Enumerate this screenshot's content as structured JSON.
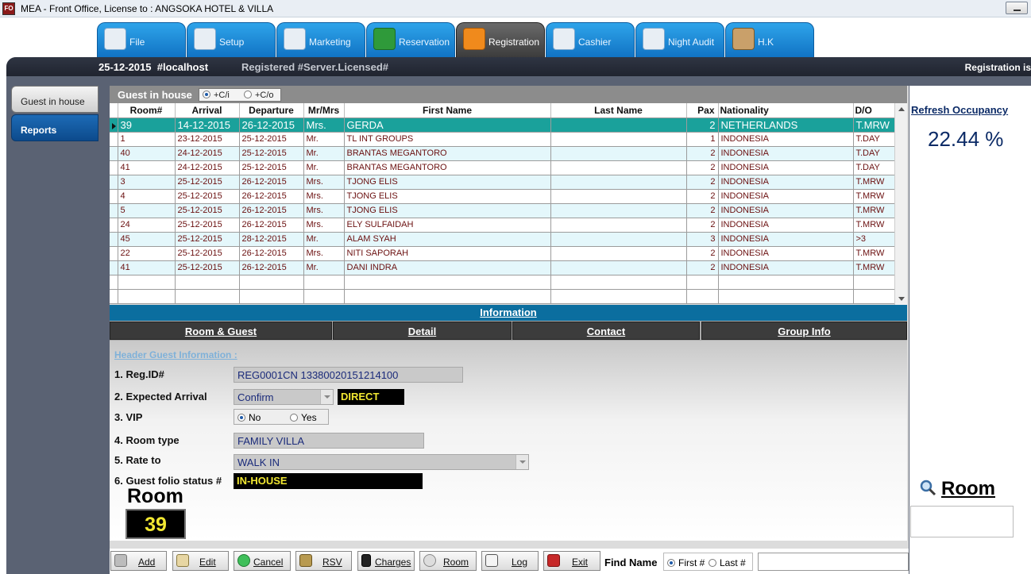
{
  "window": {
    "title": "MEA - Front Office, License to : ANGSOKA HOTEL & VILLA",
    "app_icon": "FO"
  },
  "tabs": [
    {
      "label": "File",
      "icon": "file-icon",
      "active": false
    },
    {
      "label": "Setup",
      "icon": "setup-icon",
      "active": false
    },
    {
      "label": "Marketing",
      "icon": "marketing-icon",
      "active": false
    },
    {
      "label": "Reservation",
      "icon": "reservation-icon",
      "active": false
    },
    {
      "label": "Registration",
      "icon": "registration-icon",
      "active": true
    },
    {
      "label": "Cashier",
      "icon": "cashier-icon",
      "active": false
    },
    {
      "label": "Night Audit",
      "icon": "night-audit-icon",
      "active": false
    },
    {
      "label": "H.K",
      "icon": "housekeeping-icon",
      "active": false
    }
  ],
  "header": {
    "date": "25-12-2015",
    "host": "#localhost",
    "registered": "Registered #Server.Licensed#",
    "right_text": "Registration is"
  },
  "sidenav": {
    "items": [
      {
        "label": "Guest in house"
      },
      {
        "label": "Reports"
      }
    ]
  },
  "grid": {
    "title": "Guest in house",
    "filter_ci": "+C/i",
    "filter_co": "+C/o",
    "columns": [
      "Room#",
      "Arrival",
      "Departure",
      "Mr/Mrs",
      "First Name",
      "Last Name",
      "Pax",
      "Nationality",
      "D/O"
    ],
    "rows": [
      [
        "39",
        "14-12-2015",
        "26-12-2015",
        "Mrs.",
        "GERDA",
        "",
        "2",
        "NETHERLANDS",
        "T.MRW"
      ],
      [
        "1",
        "23-12-2015",
        "25-12-2015",
        "Mr.",
        "TL INT GROUPS",
        "",
        "1",
        "INDONESIA",
        "T.DAY"
      ],
      [
        "40",
        "24-12-2015",
        "25-12-2015",
        "Mr.",
        "BRANTAS MEGANTORO",
        "",
        "2",
        "INDONESIA",
        "T.DAY"
      ],
      [
        "41",
        "24-12-2015",
        "25-12-2015",
        "Mr.",
        "BRANTAS MEGANTORO",
        "",
        "2",
        "INDONESIA",
        "T.DAY"
      ],
      [
        "3",
        "25-12-2015",
        "26-12-2015",
        "Mrs.",
        "TJONG ELIS",
        "",
        "2",
        "INDONESIA",
        "T.MRW"
      ],
      [
        "4",
        "25-12-2015",
        "26-12-2015",
        "Mrs.",
        "TJONG ELIS",
        "",
        "2",
        "INDONESIA",
        "T.MRW"
      ],
      [
        "5",
        "25-12-2015",
        "26-12-2015",
        "Mrs.",
        "TJONG ELIS",
        "",
        "2",
        "INDONESIA",
        "T.MRW"
      ],
      [
        "24",
        "25-12-2015",
        "26-12-2015",
        "Mrs.",
        "ELY SULFAIDAH",
        "",
        "2",
        "INDONESIA",
        "T.MRW"
      ],
      [
        "45",
        "25-12-2015",
        "28-12-2015",
        "Mr.",
        "ALAM SYAH",
        "",
        "3",
        "INDONESIA",
        ">3"
      ],
      [
        "22",
        "25-12-2015",
        "26-12-2015",
        "Mrs.",
        "NITI SAPORAH",
        "",
        "2",
        "INDONESIA",
        "T.MRW"
      ],
      [
        "41",
        "25-12-2015",
        "26-12-2015",
        "Mr.",
        "DANI INDRA",
        "",
        "2",
        "INDONESIA",
        "T.MRW"
      ]
    ]
  },
  "information": {
    "bar_label": "Information",
    "tabs": [
      "Room & Guest",
      "Detail",
      "Contact",
      "Group Info"
    ],
    "header_title": "Header Guest Information :",
    "fields": {
      "reg_id_label": "1. Reg.ID#",
      "reg_id_value": "REG0001CN 13380020151214100",
      "expected_arrival_label": "2. Expected Arrival",
      "expected_arrival_value": "Confirm",
      "expected_arrival_source": "DIRECT",
      "vip_label": "3. VIP",
      "vip_no": "No",
      "vip_yes": "Yes",
      "room_type_label": "4. Room type",
      "room_type_value": "FAMILY VILLA",
      "rate_to_label": "5. Rate to",
      "rate_to_value": "WALK IN",
      "folio_status_label": "6. Guest folio status #",
      "folio_status_value": "IN-HOUSE"
    },
    "room_title": "Room",
    "room_number": "39"
  },
  "toolbar": {
    "buttons": [
      {
        "label": "Add",
        "icon": "add-icon"
      },
      {
        "label": "Edit",
        "icon": "edit-icon"
      },
      {
        "label": "Cancel",
        "icon": "cancel-icon"
      },
      {
        "label": "RSV",
        "icon": "rsv-icon"
      },
      {
        "label": "Charges",
        "icon": "charges-icon"
      },
      {
        "label": "Room",
        "icon": "room-icon"
      },
      {
        "label": "Log",
        "icon": "log-icon"
      },
      {
        "label": "Exit",
        "icon": "exit-icon"
      }
    ],
    "find_label": "Find Name",
    "find_first": "First #",
    "find_last": "Last #"
  },
  "right_panel": {
    "refresh_label": "Refresh Occupancy",
    "occupancy": "22.44 %",
    "room_search_label": "Room"
  },
  "colors": {
    "selected_row": "#1aa19b",
    "alt_row": "#e4f7fb",
    "tab_blue": "#1a8ddd",
    "info_bar": "#0b6e9f"
  }
}
